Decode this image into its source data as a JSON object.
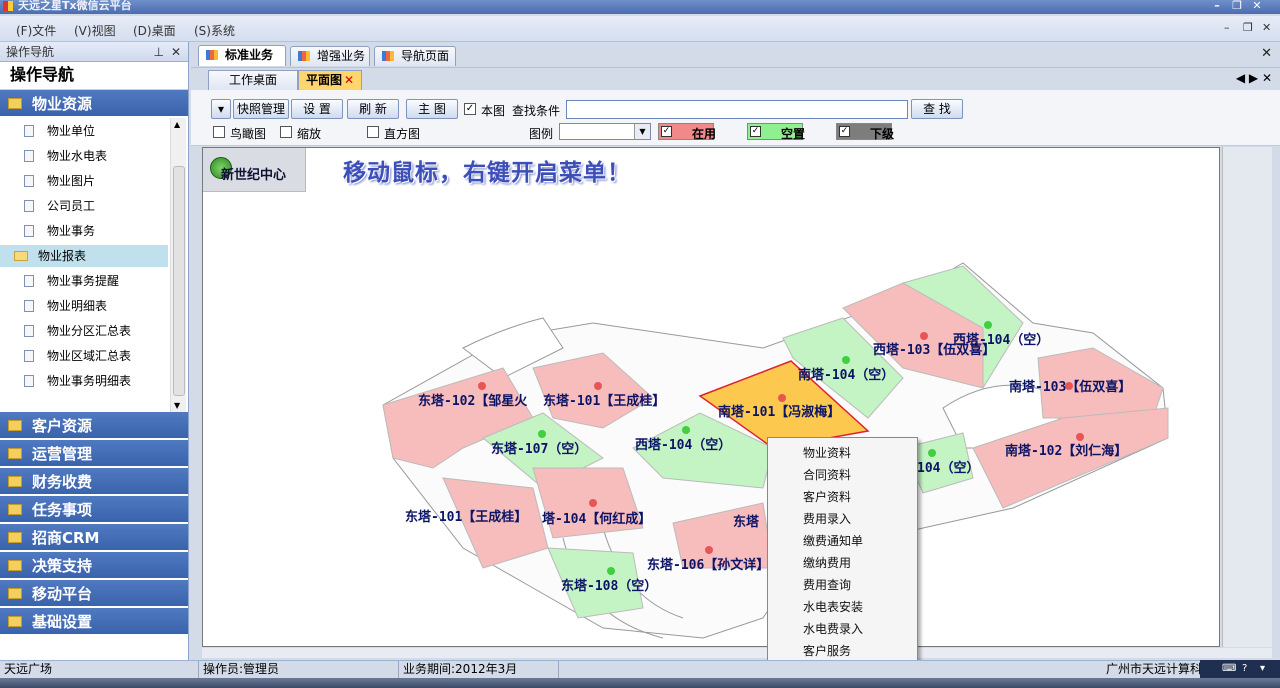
{
  "window": {
    "title": "天远之星Tx微信云平台"
  },
  "menu": [
    {
      "label": "(F)文件"
    },
    {
      "label": "(V)视图"
    },
    {
      "label": "(D)桌面"
    },
    {
      "label": "(S)系统"
    }
  ],
  "nav": {
    "panel_title": "操作导航",
    "title": "操作导航",
    "groups_top": [
      {
        "label": "物业资源"
      }
    ],
    "items": [
      {
        "label": "物业单位"
      },
      {
        "label": "物业水电表"
      },
      {
        "label": "物业图片"
      },
      {
        "label": "公司员工"
      },
      {
        "label": "物业事务"
      },
      {
        "label": "物业报表"
      },
      {
        "label": "物业事务提醒"
      },
      {
        "label": "物业明细表"
      },
      {
        "label": "物业分区汇总表"
      },
      {
        "label": "物业区域汇总表"
      },
      {
        "label": "物业事务明细表"
      }
    ],
    "groups": [
      {
        "label": "客户资源"
      },
      {
        "label": "运营管理"
      },
      {
        "label": "财务收费"
      },
      {
        "label": "任务事项"
      },
      {
        "label": "招商CRM"
      },
      {
        "label": "决策支持"
      },
      {
        "label": "移动平台"
      },
      {
        "label": "基础设置"
      }
    ]
  },
  "tabs_main": [
    {
      "label": "标准业务"
    },
    {
      "label": "增强业务"
    },
    {
      "label": "导航页面"
    }
  ],
  "tabs_sub": [
    {
      "label": "工作桌面"
    },
    {
      "label": "平面图"
    }
  ],
  "toolbar": {
    "snapshot": "快照管理",
    "settings": "设 置",
    "refresh": "刷 新",
    "main_map": "主 图",
    "this_map": "本图",
    "search_label": "查找条件",
    "search_value": "",
    "find": "查 找",
    "birdseye": "鸟瞰图",
    "zoom": "缩放",
    "histogram": "直方图",
    "legend": "图例",
    "legend_in_use": "在用",
    "legend_vacant": "空置",
    "legend_sub": "下级",
    "colors": {
      "in_use": "#f08a8a",
      "vacant": "#8ef08e",
      "sub": "#7d7d7d"
    }
  },
  "map": {
    "badge": "新世纪中心",
    "hint": "移动鼠标，右键开启菜单！",
    "rooms": [
      {
        "label": "东塔-102【邹星火"
      },
      {
        "label": "东塔-101【王成桂】"
      },
      {
        "label": "南塔-101【冯淑梅】"
      },
      {
        "label": "南塔-104（空）"
      },
      {
        "label": "西塔-103【伍双喜】"
      },
      {
        "label": "西塔-104（空）"
      },
      {
        "label": "南塔-103【伍双喜】"
      },
      {
        "label": "东塔-107（空）"
      },
      {
        "label": "西塔-104（空）"
      },
      {
        "label": "南塔-102【刘仁海】"
      },
      {
        "label": "104（空）"
      },
      {
        "label": "东塔-101【王成桂】"
      },
      {
        "label": "塔-104【何红成】"
      },
      {
        "label": "东塔"
      },
      {
        "label": "东塔-106【孙文详】"
      },
      {
        "label": "东塔-108（空）"
      }
    ],
    "colors": {
      "in_use": "#f7bcbc",
      "vacant": "#c4f3c4",
      "selected": "#fcc84e",
      "marker_red": "#e85555",
      "marker_green": "#3fcf3f"
    }
  },
  "context_menu": [
    {
      "label": "物业资料"
    },
    {
      "label": "合同资料"
    },
    {
      "label": "客户资料"
    },
    {
      "label": "费用录入"
    },
    {
      "label": "缴费通知单"
    },
    {
      "label": "缴纳费用"
    },
    {
      "label": "费用查询"
    },
    {
      "label": "水电表安装"
    },
    {
      "label": "水电费录入"
    },
    {
      "label": "客户服务"
    }
  ],
  "status": {
    "place": "天远广场",
    "operator": "操作员:管理员",
    "period": "业务期间:2012年3月",
    "company": "广州市天远计算科"
  }
}
